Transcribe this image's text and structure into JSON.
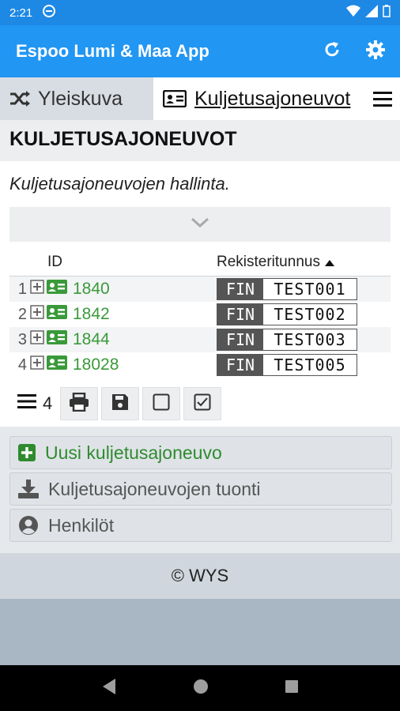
{
  "status": {
    "time": "2:21"
  },
  "app": {
    "title": "Espoo Lumi & Maa App"
  },
  "tabs": [
    {
      "label": "Yleiskuva"
    },
    {
      "label": "Kuljetusajoneuvot"
    }
  ],
  "page": {
    "title": "KULJETUSAJONEUVOT",
    "description": "Kuljetusajoneuvojen hallinta."
  },
  "table": {
    "columns": {
      "id": "ID",
      "reg": "Rekisteritunnus"
    },
    "rows": [
      {
        "num": "1",
        "id": "1840",
        "country": "FIN",
        "plate": "TEST001"
      },
      {
        "num": "2",
        "id": "1842",
        "country": "FIN",
        "plate": "TEST002"
      },
      {
        "num": "3",
        "id": "1844",
        "country": "FIN",
        "plate": "TEST003"
      },
      {
        "num": "4",
        "id": "18028",
        "country": "FIN",
        "plate": "TEST005"
      }
    ],
    "count": "4"
  },
  "actions": {
    "new_vehicle": "Uusi kuljetusajoneuvo",
    "import": "Kuljetusajoneuvojen tuonti",
    "persons": "Henkilöt"
  },
  "footer": {
    "text": "© WYS"
  },
  "colors": {
    "appbar": "#2196f3",
    "statusbar": "#1e88e5",
    "link_green": "#3a9a3a"
  }
}
